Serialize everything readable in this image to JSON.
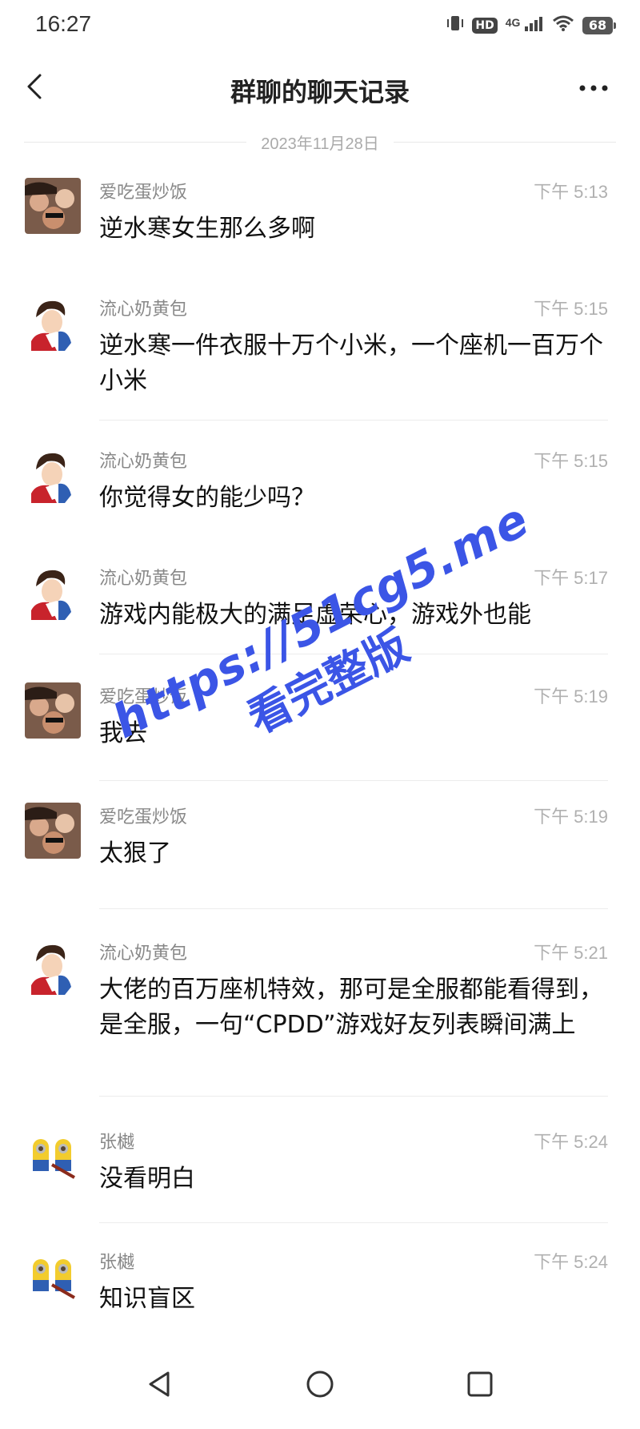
{
  "status_bar": {
    "time": "16:27",
    "hd": "HD",
    "network": "4G",
    "battery": "68"
  },
  "header": {
    "title": "群聊的聊天记录",
    "back_icon": "chevron-left-icon",
    "more_icon": "more-horizontal-icon"
  },
  "date": "2023年11月28日",
  "messages": [
    {
      "sender": "爱吃蛋炒饭",
      "time": "下午 5:13",
      "text": "逆水寒女生那么多啊",
      "avatar": "group-photo-avatar"
    },
    {
      "sender": "流心奶黄包",
      "time": "下午 5:15",
      "text": "逆水寒一件衣服十万个小米，一个座机一百万个小米",
      "avatar": "cartoon-prince-avatar"
    },
    {
      "sender": "流心奶黄包",
      "time": "下午 5:15",
      "text": "你觉得女的能少吗？",
      "avatar": "cartoon-prince-avatar"
    },
    {
      "sender": "流心奶黄包",
      "time": "下午 5:17",
      "text": "游戏内能极大的满足虚荣心，游戏外也能",
      "avatar": "cartoon-prince-avatar"
    },
    {
      "sender": "爱吃蛋炒饭",
      "time": "下午 5:19",
      "text": "我去",
      "avatar": "group-photo-avatar"
    },
    {
      "sender": "爱吃蛋炒饭",
      "time": "下午 5:19",
      "text": "太狠了",
      "avatar": "group-photo-avatar"
    },
    {
      "sender": "流心奶黄包",
      "time": "下午 5:21",
      "text": "大佬的百万座机特效，那可是全服都能看得到，是全服，一句“CPDD”游戏好友列表瞬间满上",
      "avatar": "cartoon-prince-avatar"
    },
    {
      "sender": "张樾",
      "time": "下午 5:24",
      "text": "没看明白",
      "avatar": "minions-avatar"
    },
    {
      "sender": "张樾",
      "time": "下午 5:24",
      "text": "知识盲区",
      "avatar": "minions-avatar"
    }
  ],
  "watermark": {
    "line1": "https://51cg5.me",
    "line2": "看完整版"
  },
  "navbar": {
    "back_icon": "triangle-back-icon",
    "home_icon": "circle-home-icon",
    "recents_icon": "square-recents-icon"
  },
  "colors": {
    "watermark": "#3b55e6",
    "time": "#b0b0b0",
    "sender": "#888888"
  }
}
